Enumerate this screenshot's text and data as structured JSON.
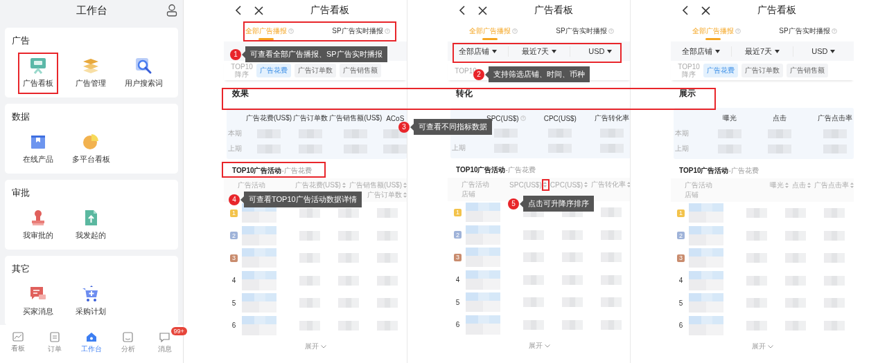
{
  "workbench": {
    "title": "工作台",
    "sections": [
      {
        "title": "广告",
        "items": [
          {
            "label": "广告看板",
            "kind": "ad-board"
          },
          {
            "label": "广告管理",
            "kind": "layers"
          },
          {
            "label": "用户搜索词",
            "kind": "search"
          }
        ]
      },
      {
        "title": "数据",
        "items": [
          {
            "label": "在线产品",
            "kind": "product"
          },
          {
            "label": "多平台看板",
            "kind": "pie"
          }
        ]
      },
      {
        "title": "审批",
        "items": [
          {
            "label": "我审批的",
            "kind": "stamp"
          },
          {
            "label": "我发起的",
            "kind": "upload"
          }
        ]
      },
      {
        "title": "其它",
        "items": [
          {
            "label": "买家消息",
            "kind": "message"
          },
          {
            "label": "采购计划",
            "kind": "cart"
          }
        ]
      }
    ],
    "tabbar": [
      {
        "label": "看板",
        "kind": "chart",
        "selected": false
      },
      {
        "label": "订单",
        "kind": "order",
        "selected": false
      },
      {
        "label": "工作台",
        "kind": "home",
        "selected": true
      },
      {
        "label": "分析",
        "kind": "analysis",
        "selected": false
      },
      {
        "label": "消息",
        "kind": "chat",
        "selected": false,
        "badge": "99+"
      }
    ]
  },
  "screens": [
    {
      "title": "广告看板",
      "tabs": [
        {
          "label": "全部广告播报",
          "selected": true,
          "help": true
        },
        {
          "label": "SP广告实时播报",
          "selected": false,
          "help": true
        }
      ],
      "sort_label": "TOP10 降序",
      "sort_chips": [
        {
          "label": "广告花费",
          "selected": true
        },
        {
          "label": "广告订单数",
          "selected": false
        },
        {
          "label": "广告销售额",
          "selected": false
        }
      ],
      "section_title": "效果",
      "metrics": {
        "columns": [
          {
            "label": "广告花费(US$)"
          },
          {
            "label": "广告订单数"
          },
          {
            "label": "广告销售额(US$)"
          },
          {
            "label": "ACoS"
          }
        ],
        "rows": [
          {
            "label": "本期"
          },
          {
            "label": "上期"
          }
        ]
      },
      "top10": {
        "title": "TOP10广告活动",
        "metric": "-广告花费"
      },
      "table": {
        "first_column": [
          "广告活动"
        ],
        "columns": [
          "广告花费(US$)",
          "广告销售额(US$)",
          "广告订单数"
        ],
        "rows": [
          {
            "rank": "1",
            "kind": "medal",
            "color": "#f3c34b"
          },
          {
            "rank": "2",
            "kind": "medal",
            "color": "#9fb3d9"
          },
          {
            "rank": "3",
            "kind": "medal",
            "color": "#c98c6e"
          },
          {
            "rank": "4",
            "kind": "plain"
          },
          {
            "rank": "5",
            "kind": "plain"
          },
          {
            "rank": "6",
            "kind": "plain"
          }
        ]
      },
      "expand": "展开"
    },
    {
      "title": "广告看板",
      "tabs": [
        {
          "label": "全部广告播报",
          "selected": true,
          "help": true
        },
        {
          "label": "SP广告实时播报",
          "selected": false,
          "help": true
        }
      ],
      "filters": [
        "全部店铺",
        "最近7天",
        "USD"
      ],
      "sort_label": "TOP10",
      "section_title": "转化",
      "metrics": {
        "columns": [
          {
            "label": "SPC(US$)",
            "help": true
          },
          {
            "label": "CPC(US$)"
          },
          {
            "label": "广告转化率"
          }
        ],
        "rows": [
          {},
          {
            "label": "上期"
          }
        ]
      },
      "top10": {
        "title": "TOP10广告活动",
        "metric": "-广告花费"
      },
      "table": {
        "first_column": [
          "广告活动",
          "店铺"
        ],
        "columns": [
          "SPC(US$)",
          "CPC(US$)",
          "广告转化率"
        ],
        "rows": [
          {
            "rank": "1",
            "kind": "medal",
            "color": "#f3c34b"
          },
          {
            "rank": "2",
            "kind": "medal",
            "color": "#9fb3d9"
          },
          {
            "rank": "3",
            "kind": "medal",
            "color": "#c98c6e"
          },
          {
            "rank": "4",
            "kind": "plain"
          },
          {
            "rank": "5",
            "kind": "plain"
          },
          {
            "rank": "6",
            "kind": "plain"
          }
        ]
      },
      "expand": "展开"
    },
    {
      "title": "广告看板",
      "tabs": [
        {
          "label": "全部广告播报",
          "selected": true,
          "help": true
        },
        {
          "label": "SP广告实时播报",
          "selected": false,
          "help": true
        }
      ],
      "filters": [
        "全部店铺",
        "最近7天",
        "USD"
      ],
      "sort_label": "TOP10 降序",
      "sort_chips": [
        {
          "label": "广告花费",
          "selected": true
        },
        {
          "label": "广告订单数",
          "selected": false
        },
        {
          "label": "广告销售额",
          "selected": false
        }
      ],
      "section_title": "展示",
      "metrics": {
        "columns": [
          {
            "label": "曝光"
          },
          {
            "label": "点击"
          },
          {
            "label": "广告点击率"
          }
        ],
        "rows": [
          {
            "label": "本期"
          },
          {
            "label": "上期"
          }
        ]
      },
      "top10": {
        "title": "TOP10广告活动",
        "metric": "-广告花费"
      },
      "table": {
        "first_column": [
          "广告活动",
          "店铺"
        ],
        "columns": [
          "曝光",
          "点击",
          "广告点击率"
        ],
        "rows": [
          {
            "rank": "1",
            "kind": "medal",
            "color": "#f3c34b"
          },
          {
            "rank": "2",
            "kind": "medal",
            "color": "#9fb3d9"
          },
          {
            "rank": "3",
            "kind": "medal",
            "color": "#c98c6e"
          },
          {
            "rank": "4",
            "kind": "plain"
          },
          {
            "rank": "5",
            "kind": "plain"
          },
          {
            "rank": "6",
            "kind": "plain"
          }
        ]
      },
      "expand": "展开"
    }
  ],
  "callouts": [
    {
      "number": "1",
      "text": "可查看全部广告播报、SP广告实时播报"
    },
    {
      "number": "2",
      "text": "支持筛选店铺、时间、币种"
    },
    {
      "number": "3",
      "text": "可查看不同指标数据"
    },
    {
      "number": "4",
      "text": "可查看TOP10广告活动数据详情"
    },
    {
      "number": "5",
      "text": "点击可升降序排序"
    }
  ]
}
